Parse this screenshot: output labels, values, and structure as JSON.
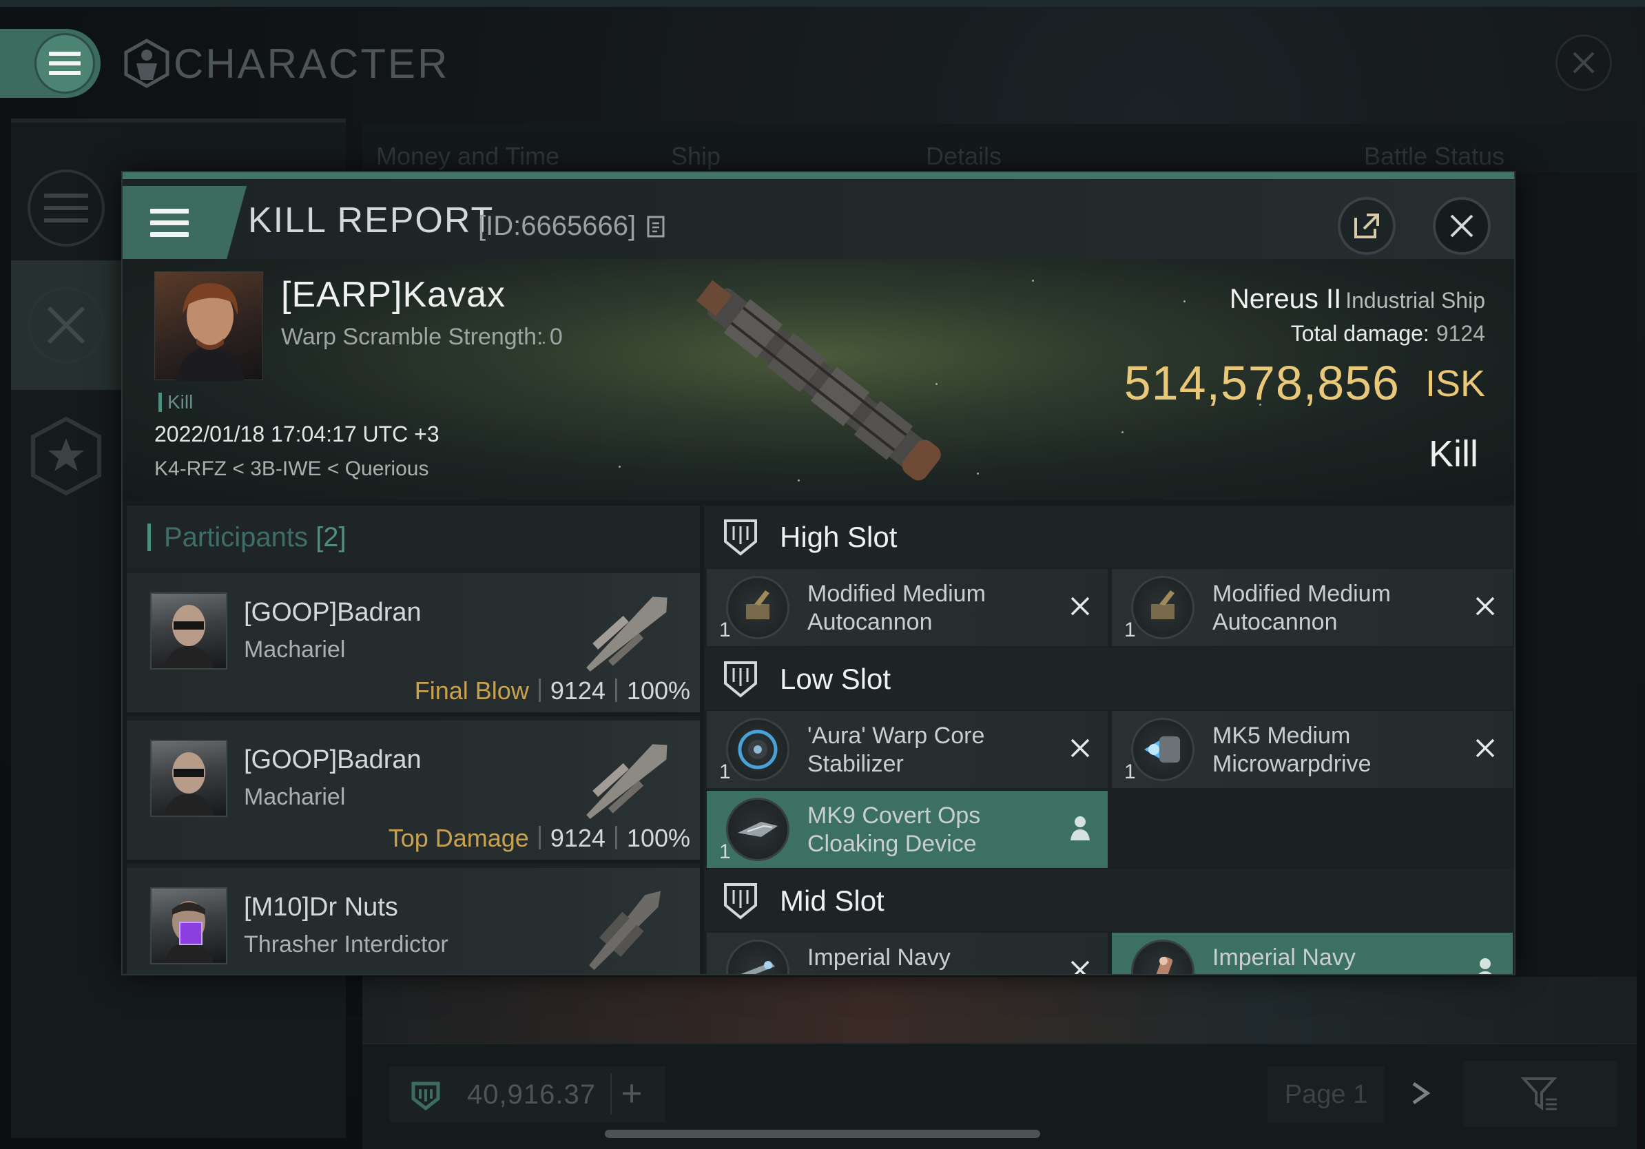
{
  "background_window": {
    "title": "CHARACTER",
    "tabs": [
      "Money and Time",
      "Ship",
      "Details",
      "Battle Status"
    ],
    "wallet_value": "40,916.37",
    "page_label": "Page 1"
  },
  "kill_report": {
    "title": "KILL REPORT",
    "id_label": "[ID:6665666]",
    "victim": {
      "name": "[EARP]Kavax",
      "warp_scramble": "Warp Scramble Strength: 0",
      "tag": "Kill",
      "datetime": "2022/01/18 17:04:17 UTC +3",
      "location": "K4-RFZ < 3B-IWE < Querious"
    },
    "ship": {
      "name": "Nereus II",
      "class": "Industrial Ship",
      "total_damage_label": "Total damage:",
      "total_damage": "9124",
      "isk_value": "514,578,856",
      "isk_unit": "ISK",
      "result": "Kill"
    },
    "participants": {
      "title": "Participants",
      "count": "[2]",
      "rows": [
        {
          "name": "[GOOP]Badran",
          "ship": "Machariel",
          "role": "Final Blow",
          "damage": "9124",
          "percent": "100%"
        },
        {
          "name": "[GOOP]Badran",
          "ship": "Machariel",
          "role": "Top Damage",
          "damage": "9124",
          "percent": "100%"
        },
        {
          "name": "[M10]Dr Nuts",
          "ship": "Thrasher Interdictor",
          "role": "",
          "damage": "",
          "percent": ""
        }
      ]
    },
    "slots": {
      "high": {
        "title": "High Slot",
        "modules": [
          {
            "qty": "1",
            "name": "Modified Medium Autocannon",
            "icon": "autocannon-icon",
            "state": "destroyed"
          },
          {
            "qty": "1",
            "name": "Modified Medium Autocannon",
            "icon": "autocannon-icon",
            "state": "destroyed"
          }
        ]
      },
      "low": {
        "title": "Low Slot",
        "modules": [
          {
            "qty": "1",
            "name": "'Aura' Warp Core Stabilizer",
            "icon": "warp-core-stabilizer-icon",
            "state": "destroyed"
          },
          {
            "qty": "1",
            "name": "MK5 Medium Microwarpdrive",
            "icon": "microwarpdrive-icon",
            "state": "destroyed"
          },
          {
            "qty": "1",
            "name": "MK9 Covert Ops Cloaking Device",
            "icon": "cloaking-device-icon",
            "state": "dropped"
          }
        ]
      },
      "mid": {
        "title": "Mid Slot",
        "modules": [
          {
            "qty": "",
            "name": "Imperial Navy",
            "icon": "imperial-navy-module-icon",
            "state": "destroyed"
          },
          {
            "qty": "",
            "name": "Imperial Navy",
            "icon": "imperial-navy-module-icon",
            "state": "dropped"
          }
        ]
      }
    }
  },
  "colors": {
    "accent_teal": "#3d6b60",
    "isk_gold": "#e9c87a",
    "role_gold": "#c8a24f",
    "dropped_highlight": "#3c7063"
  }
}
